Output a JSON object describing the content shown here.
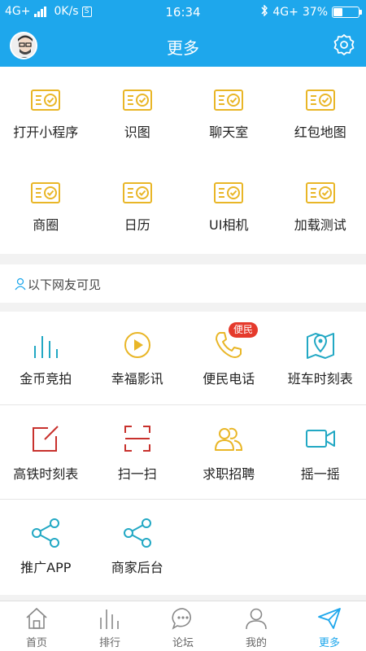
{
  "status_bar": {
    "network_left": "4G+",
    "speed": "0K/s",
    "net_icon": "S",
    "time": "16:34",
    "network_right": "4G+",
    "battery": "37%",
    "battery_level": 0.37
  },
  "header": {
    "title": "更多"
  },
  "grid1": [
    {
      "label": "打开小程序",
      "icon": "ticket-check-icon"
    },
    {
      "label": "识图",
      "icon": "ticket-check-icon"
    },
    {
      "label": "聊天室",
      "icon": "ticket-check-icon"
    },
    {
      "label": "红包地图",
      "icon": "ticket-check-icon"
    },
    {
      "label": "商圈",
      "icon": "ticket-check-icon"
    },
    {
      "label": "日历",
      "icon": "ticket-check-icon"
    },
    {
      "label": "UI相机",
      "icon": "ticket-check-icon"
    },
    {
      "label": "加载测试",
      "icon": "ticket-check-icon"
    }
  ],
  "visibility_note": "以下网友可见",
  "grid2": [
    {
      "label": "金币竞拍",
      "icon": "bar-chart-icon"
    },
    {
      "label": "幸福影讯",
      "icon": "play-circle-icon"
    },
    {
      "label": "便民电话",
      "icon": "phone-icon",
      "badge": "便民"
    },
    {
      "label": "班车时刻表",
      "icon": "map-pin-icon"
    },
    {
      "label": "高铁时刻表",
      "icon": "edit-square-icon"
    },
    {
      "label": "扫一扫",
      "icon": "scan-icon"
    },
    {
      "label": "求职招聘",
      "icon": "people-icon"
    },
    {
      "label": "摇一摇",
      "icon": "video-camera-icon"
    },
    {
      "label": "推广APP",
      "icon": "share-icon"
    },
    {
      "label": "商家后台",
      "icon": "share-icon"
    }
  ],
  "tabs": [
    {
      "label": "首页",
      "icon": "home-icon",
      "active": false
    },
    {
      "label": "排行",
      "icon": "bars-icon",
      "active": false
    },
    {
      "label": "论坛",
      "icon": "chat-bubble-icon",
      "active": false
    },
    {
      "label": "我的",
      "icon": "user-icon",
      "active": false
    },
    {
      "label": "更多",
      "icon": "paper-plane-icon",
      "active": true
    }
  ],
  "colors": {
    "accent": "#1ea7ec",
    "gold": "#e9b627",
    "red": "#c8312d",
    "teal": "#22a8c4",
    "badge": "#e53a2c"
  }
}
